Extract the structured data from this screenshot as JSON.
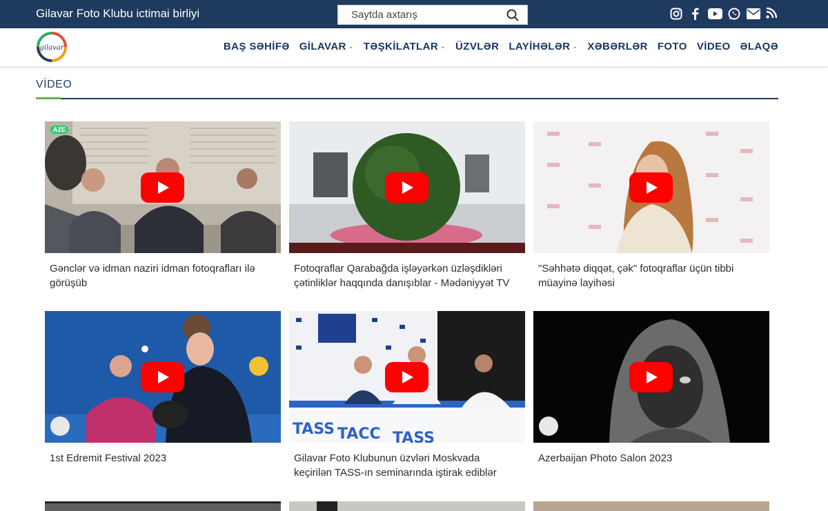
{
  "topbar": {
    "site_title": "Gilavar Foto Klubu ictimai birliyi",
    "search_placeholder": "Saytda axtarış",
    "social": [
      "instagram-icon",
      "facebook-icon",
      "youtube-icon",
      "whatsapp-icon",
      "mail-icon",
      "rss-icon"
    ]
  },
  "nav": {
    "logo_text": "gilavar",
    "items": [
      {
        "label": "BAŞ SƏHİFƏ",
        "dropdown": false
      },
      {
        "label": "GİLAVAR",
        "dropdown": true
      },
      {
        "label": "TƏŞKİLATLAR",
        "dropdown": true
      },
      {
        "label": "ÜZVLƏR",
        "dropdown": false
      },
      {
        "label": "LAYİHƏLƏR",
        "dropdown": true
      },
      {
        "label": "XƏBƏRLƏR",
        "dropdown": false
      },
      {
        "label": "FOTO",
        "dropdown": false
      },
      {
        "label": "VİDEO",
        "dropdown": false
      },
      {
        "label": "ƏLAQƏ",
        "dropdown": false
      }
    ]
  },
  "section": {
    "title": "VİDEO"
  },
  "videos": [
    {
      "title": "Gənclər və idman naziri idman fotoqrafları ilə görüşüb",
      "badge": "AZE"
    },
    {
      "title": "Fotoqraflar Qarabağda işləyərkən üzləşdikləri çətinliklər haqqında danışıblar - Mədəniyyət TV",
      "badge": ""
    },
    {
      "title": "\"Səhhətə diqqət, çək\" fotoqraflar üçün tibbi müayinə layihəsi",
      "badge": ""
    },
    {
      "title": "1st Edremit Festival 2023",
      "badge": ""
    },
    {
      "title": "Gilavar Foto Klubunun üzvləri Moskvada keçirilən TASS-ın seminarında iştirak ediblər",
      "badge": ""
    },
    {
      "title": "Azerbaijan Photo Salon 2023",
      "badge": ""
    }
  ],
  "colors": {
    "primary": "#1f3a5f",
    "accent": "#6ab04c",
    "play": "#ff0000"
  }
}
